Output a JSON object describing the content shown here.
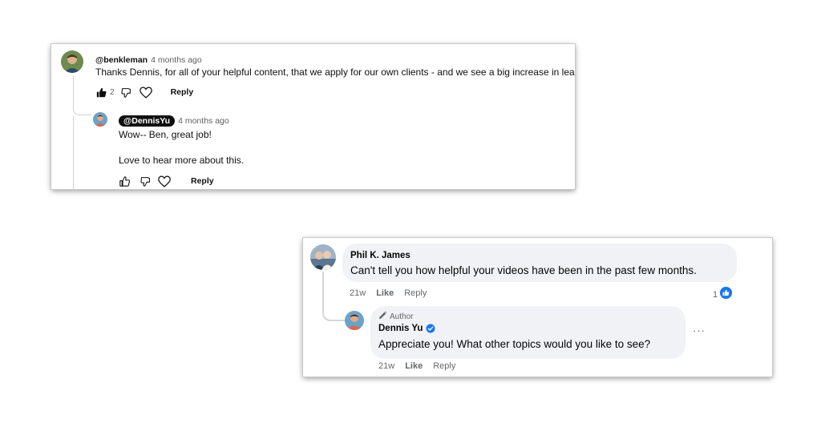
{
  "youtube": {
    "comment": {
      "handle": "@benkleman",
      "time": "4 months ago",
      "text": "Thanks Dennis, for all of your helpful content, that we apply for our own clients - and we see a big increase in leads...",
      "like_count": "2",
      "reply_label": "Reply"
    },
    "reply": {
      "handle": "@DennisYu",
      "time": "4 months ago",
      "line1": "Wow-- Ben, great job!",
      "line2": "Love to hear more about this.",
      "reply_label": "Reply"
    }
  },
  "facebook": {
    "comment": {
      "author": "Phil K. James",
      "text": "Can't tell you how helpful your videos have been in the past few months.",
      "time": "21w",
      "like_label": "Like",
      "reply_label": "Reply",
      "reaction_count": "1"
    },
    "reply": {
      "badge": "Author",
      "author": "Dennis Yu",
      "text": "Appreciate you! What other topics would you like to see?",
      "time": "21w",
      "like_label": "Like",
      "reply_label": "Reply",
      "more_label": "···"
    }
  },
  "colors": {
    "fb_blue": "#1877f2",
    "bubble_bg": "#f0f2f5",
    "yt_pill": "#0f0f0f"
  }
}
